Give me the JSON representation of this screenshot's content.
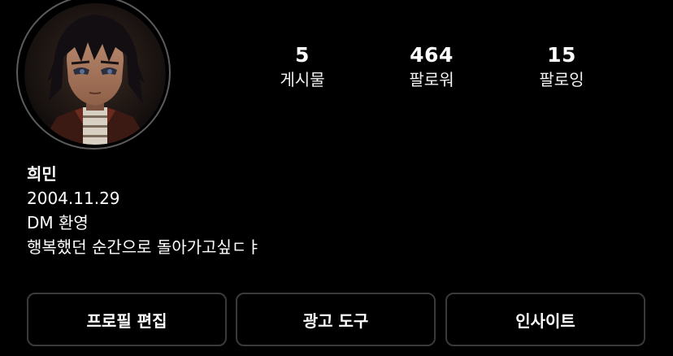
{
  "profile": {
    "avatar_icon": "profile-picture-anime-character",
    "name": "희민",
    "bio_lines": [
      "2004.11.29",
      "DM 환영",
      "행복했던 순간으로 돌아가고싶ㄷㅑ"
    ]
  },
  "stats": {
    "posts": {
      "value": "5",
      "label": "게시물"
    },
    "followers": {
      "value": "464",
      "label": "팔로워"
    },
    "following": {
      "value": "15",
      "label": "팔로잉"
    }
  },
  "buttons": {
    "edit_profile": "프로필 편집",
    "ad_tools": "광고 도구",
    "insights": "인사이트"
  },
  "colors": {
    "background": "#000000",
    "text": "#ffffff",
    "button_border": "#3a3a3a",
    "avatar_ring": "#5c5c5c"
  }
}
